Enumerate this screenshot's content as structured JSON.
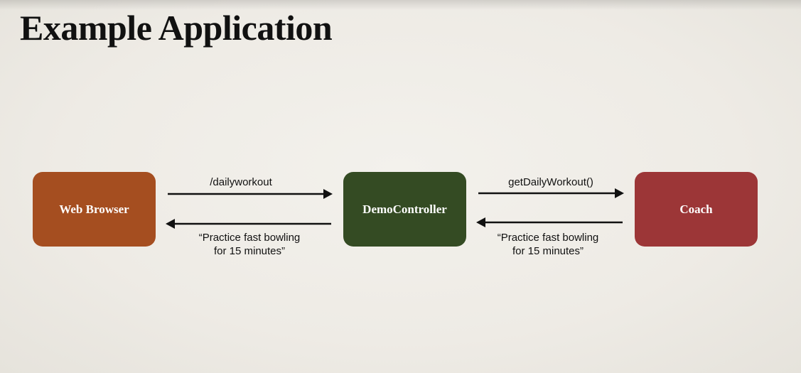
{
  "slide": {
    "title": "Example Application"
  },
  "diagram": {
    "nodes": {
      "browser": {
        "label": "Web Browser",
        "color": "#a54e20"
      },
      "controller": {
        "label": "DemoController",
        "color": "#344b23"
      },
      "coach": {
        "label": "Coach",
        "color": "#9c3637"
      }
    },
    "edges": {
      "request": "/dailyworkout",
      "call": "getDailyWorkout()",
      "response_to_controller": "“Practice fast bowling\nfor 15 minutes”",
      "response_to_browser": "“Practice fast bowling\nfor 15 minutes”"
    }
  }
}
